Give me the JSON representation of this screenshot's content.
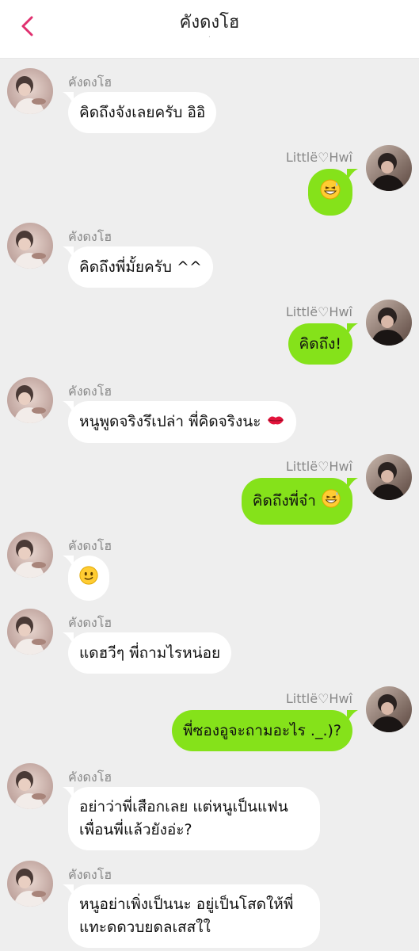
{
  "header": {
    "title": "คังดงโฮ",
    "subtitle": "·"
  },
  "colors": {
    "background": "#eeeeee",
    "incoming_bubble": "#ffffff",
    "outgoing_bubble": "#85e21a",
    "accent": "#e0306f"
  },
  "messages": [
    {
      "side": "left",
      "sender": "คังดงโฮ",
      "text": "คิดถึงจังเลยครับ อิอิ",
      "emoji": ""
    },
    {
      "side": "right",
      "sender": "Littlë♡Hwî",
      "text": "",
      "emoji": "grinning-sweat-emoji"
    },
    {
      "side": "left",
      "sender": "คังดงโฮ",
      "text": "คิดถึงพี่มั้ยครับ ^^",
      "emoji": ""
    },
    {
      "side": "right",
      "sender": "Littlë♡Hwî",
      "text": "คิดถึง!",
      "emoji": ""
    },
    {
      "side": "left",
      "sender": "คังดงโฮ",
      "text": "หนูพูดจริงรึเปล่า พี่คิดจริงนะ",
      "emoji": "kiss-lips-emoji"
    },
    {
      "side": "right",
      "sender": "Littlë♡Hwî",
      "text": "คิดถึงพี่จ๋า",
      "emoji": "grinning-sweat-emoji"
    },
    {
      "side": "left",
      "sender": "คังดงโฮ",
      "text": "",
      "emoji": "smiling-face-emoji"
    },
    {
      "side": "left",
      "sender": "คังดงโฮ",
      "text": "แดฮวีๆ พี่ถามไรหน่อย",
      "emoji": ""
    },
    {
      "side": "right",
      "sender": "Littlë♡Hwî",
      "text": "พี่ซองอูจะถามอะไร ._.)?",
      "emoji": ""
    },
    {
      "side": "left",
      "sender": "คังดงโฮ",
      "text": "อย่าว่าพี่เสือกเลย แต่หนูเป็นแฟนเพื่อนพี่แล้วยังอ่ะ?",
      "emoji": ""
    },
    {
      "side": "left",
      "sender": "คังดงโฮ",
      "text": "หนูอย่าเพิ่งเป็นนะ อยู่เป็นโสดให้พี่แทะดดวบยดลเสสใใ",
      "emoji": ""
    }
  ]
}
